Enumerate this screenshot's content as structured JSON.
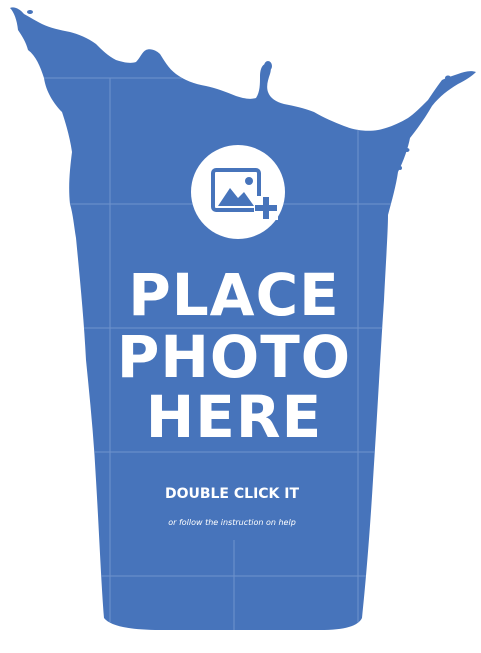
{
  "placeholder": {
    "headline_line1": "PLACE",
    "headline_line2": "PHOTO",
    "headline_line3": "HERE",
    "action": "DOUBLE CLICK IT",
    "hint": "or follow the instruction on help"
  },
  "icons": {
    "add_photo": "add-photo-icon"
  },
  "colors": {
    "fill": "#4774bb",
    "guide_lines": "#6f93cc",
    "icon_circle": "#ffffff",
    "icon_glyph": "#4774bb",
    "background": "#ffffff"
  }
}
